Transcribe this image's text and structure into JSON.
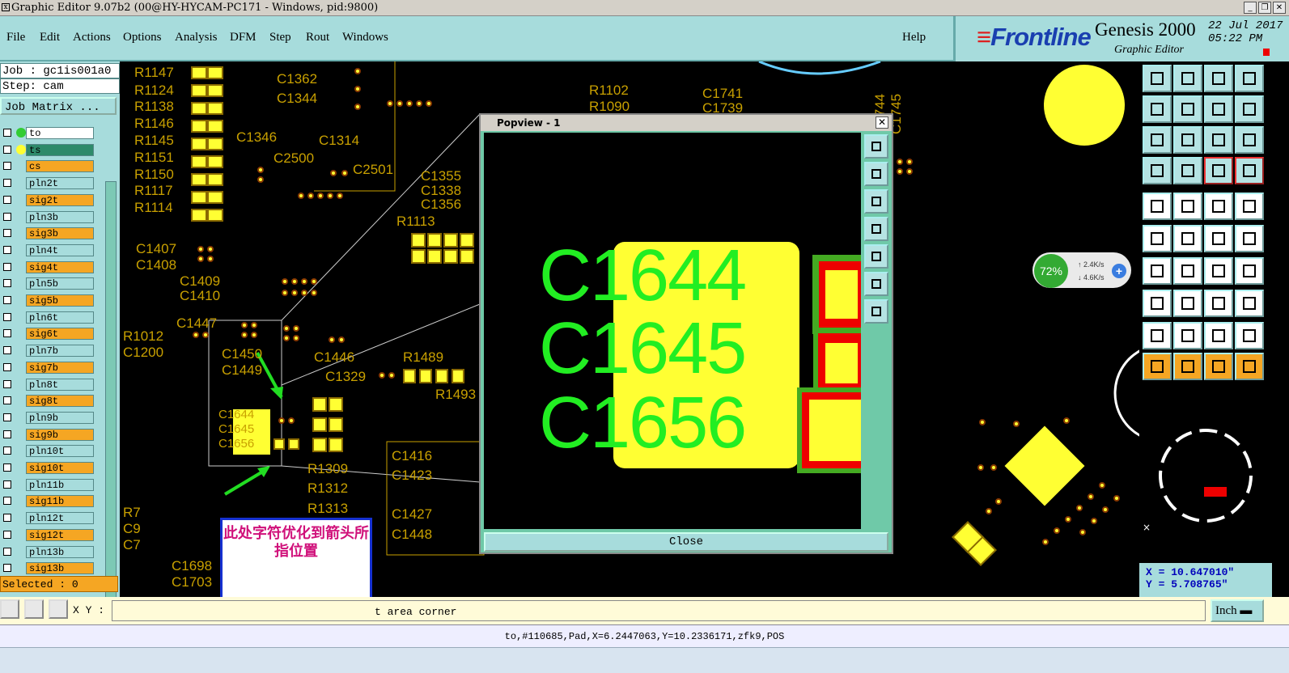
{
  "window": {
    "title": "Graphic Editor 9.07b2 (00@HY-HYCAM-PC171 - Windows, pid:9800)"
  },
  "menu": {
    "items": [
      "File",
      "Edit",
      "Actions",
      "Options",
      "Analysis",
      "DFM",
      "Step",
      "Rout",
      "Windows"
    ],
    "help": "Help"
  },
  "brand": {
    "logo": "Frontline",
    "product": "Genesis 2000",
    "subtitle": "Graphic Editor",
    "date": "22 Jul 2017",
    "time": "05:22 PM"
  },
  "left_panel": {
    "job": "Job : gc1is001a0",
    "step": "Step: cam",
    "job_matrix": "Job Matrix ...",
    "layers": [
      {
        "name": "to",
        "color": "#ffffff",
        "dot": "#3c3"
      },
      {
        "name": "ts",
        "color": "#2e8a6a",
        "dot": "#ff3"
      },
      {
        "name": "cs",
        "color": "#f5a623"
      },
      {
        "name": "pln2t",
        "color": "#a7dcdc"
      },
      {
        "name": "sig2t",
        "color": "#f5a623"
      },
      {
        "name": "pln3b",
        "color": "#a7dcdc"
      },
      {
        "name": "sig3b",
        "color": "#f5a623"
      },
      {
        "name": "pln4t",
        "color": "#a7dcdc"
      },
      {
        "name": "sig4t",
        "color": "#f5a623"
      },
      {
        "name": "pln5b",
        "color": "#a7dcdc"
      },
      {
        "name": "sig5b",
        "color": "#f5a623"
      },
      {
        "name": "pln6t",
        "color": "#a7dcdc"
      },
      {
        "name": "sig6t",
        "color": "#f5a623"
      },
      {
        "name": "pln7b",
        "color": "#a7dcdc"
      },
      {
        "name": "sig7b",
        "color": "#f5a623"
      },
      {
        "name": "pln8t",
        "color": "#a7dcdc"
      },
      {
        "name": "sig8t",
        "color": "#f5a623"
      },
      {
        "name": "pln9b",
        "color": "#a7dcdc"
      },
      {
        "name": "sig9b",
        "color": "#f5a623"
      },
      {
        "name": "pln10t",
        "color": "#a7dcdc"
      },
      {
        "name": "sig10t",
        "color": "#f5a623"
      },
      {
        "name": "pln11b",
        "color": "#a7dcdc"
      },
      {
        "name": "sig11b",
        "color": "#f5a623"
      },
      {
        "name": "pln12t",
        "color": "#a7dcdc"
      },
      {
        "name": "sig12t",
        "color": "#f5a623"
      },
      {
        "name": "pln13b",
        "color": "#a7dcdc"
      },
      {
        "name": "sig13b",
        "color": "#f5a623"
      }
    ],
    "selected": "Selected : 0"
  },
  "canvas_labels": [
    "R1147",
    "R1124",
    "R1138",
    "R1146",
    "R1145",
    "R1151",
    "R1150",
    "R1117",
    "R1114",
    "C1362",
    "C1344",
    "C1346",
    "C1314",
    "C2500",
    "C2501",
    "C1355",
    "C1338",
    "C1356",
    "R1102",
    "R1090",
    "C1741",
    "C1739",
    "C1744",
    "C1745",
    "C1407",
    "C1408",
    "C1409",
    "C1410",
    "R1113",
    "C1447",
    "R1012",
    "C1200",
    "C1450",
    "C1449",
    "C1446",
    "R1489",
    "C1329",
    "R1493",
    "R1309",
    "R1312",
    "R1313",
    "C1416",
    "C1423",
    "C1427",
    "C1448",
    "R7",
    "C9",
    "C7",
    "C1698",
    "C1703",
    "C1644",
    "C1645",
    "C1656"
  ],
  "popup": {
    "title": "Popview - 1",
    "labels": [
      "C1644",
      "C1645",
      "C1656"
    ],
    "close": "Close"
  },
  "note": {
    "text": "此处字符优化到箭头所指位置"
  },
  "speed": {
    "percent": "72%",
    "up": "2.4K/s",
    "down": "4.6K/s"
  },
  "coords": {
    "x": "X = 10.647010\"",
    "y": "Y = 5.708765\""
  },
  "bottom": {
    "xy_label": "X Y :",
    "prompt": "t area corner",
    "unit": "Inch"
  },
  "status": {
    "text": "to,#110685,Pad,X=6.2447063,Y=10.2336171,zfk9,POS"
  },
  "colors": {
    "panel": "#a7dcdc",
    "pad": "#ffff33",
    "silk": "#c8a000",
    "arrow": "#22dd22",
    "popup_text": "#22ee22"
  }
}
